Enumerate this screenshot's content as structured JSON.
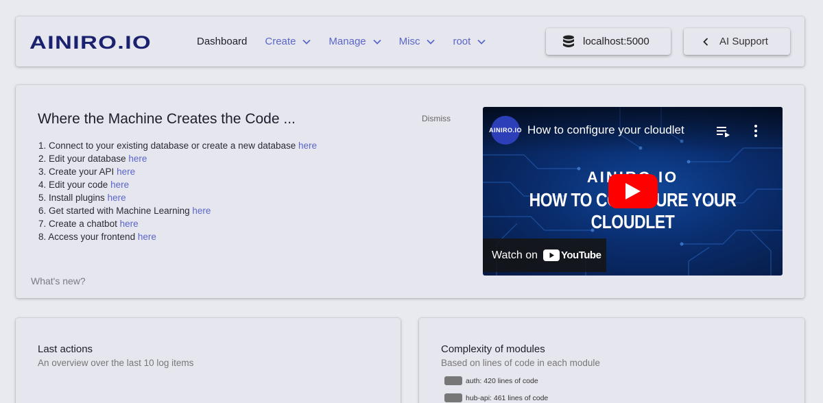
{
  "header": {
    "logo_text": "AINIRO.IO",
    "nav": [
      {
        "label": "Dashboard",
        "dropdown": false,
        "active": true
      },
      {
        "label": "Create",
        "dropdown": true
      },
      {
        "label": "Manage",
        "dropdown": true
      },
      {
        "label": "Misc",
        "dropdown": true
      },
      {
        "label": "root",
        "dropdown": true
      }
    ],
    "database_button": {
      "label": "localhost:5000",
      "icon": "database-icon"
    },
    "support_button": {
      "label": "AI Support",
      "icon": "chevron-left-icon"
    }
  },
  "welcome": {
    "title": "Where the Machine Creates the Code ...",
    "dismiss": "Dismiss",
    "link_text": "here",
    "steps": [
      "1. Connect to your existing database or create a new database",
      "2. Edit your database",
      "3. Create your API",
      "4. Edit your code",
      "5. Install plugins",
      "6. Get started with Machine Learning",
      "7. Create a chatbot",
      "8. Access your frontend"
    ],
    "whats_new": "What's new?"
  },
  "video": {
    "channel_avatar": "AINIRO.IO",
    "title": "How to configure your cloudlet",
    "brand": "AINIRO.IO",
    "headline": "HOW TO CONFIGURE YOUR CLOUDLET",
    "watch_on": "Watch on",
    "youtube": "YouTube"
  },
  "last_actions": {
    "title": "Last actions",
    "subtitle": "An overview over the last 10 log items"
  },
  "complexity": {
    "title": "Complexity of modules",
    "subtitle": "Based on lines of code in each module",
    "legend": [
      {
        "label": "auth: 420 lines of code",
        "color": "#777777"
      },
      {
        "label": "hub-api: 461 lines of code",
        "color": "#777777"
      }
    ]
  },
  "colors": {
    "accent": "#5a66c9",
    "play_button": "#ff0000",
    "video_bg": "#0a2d6e"
  }
}
